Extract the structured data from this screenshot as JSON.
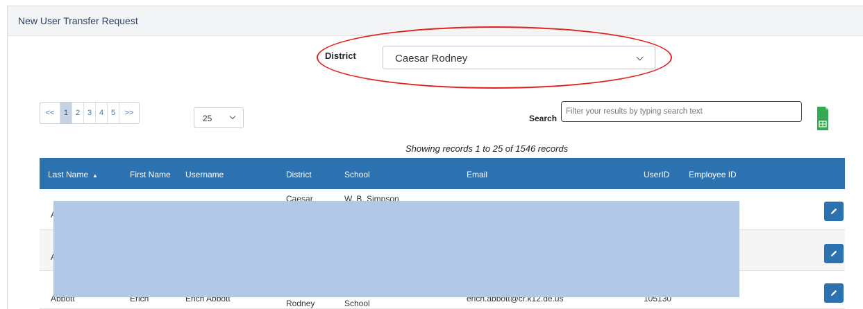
{
  "panel": {
    "title": "New User Transfer Request"
  },
  "district_filter": {
    "label": "District",
    "selected": "Caesar Rodney"
  },
  "pagination": {
    "pages": [
      "<<",
      "1",
      "2",
      "3",
      "4",
      "5",
      ">>"
    ],
    "active_page": "1",
    "page_size": "25"
  },
  "search": {
    "label": "Search",
    "placeholder": "Filter your results by typing search text"
  },
  "records_summary": "Showing records 1 to 25 of 1546 records",
  "table": {
    "columns": [
      "Last Name",
      "First Name",
      "Username",
      "District",
      "School",
      "Email",
      "UserID",
      "Employee ID"
    ],
    "sort_indicator": "▲",
    "rows": [
      {
        "last": "A",
        "first": "",
        "username": "",
        "district": "Caesar",
        "school": "W. B. Simpson",
        "email": "",
        "userid": ""
      },
      {
        "last": "A",
        "first": "",
        "username": "",
        "district": "",
        "school": "",
        "email": "",
        "userid": ""
      },
      {
        "last": "Abbott",
        "first": "Erich",
        "username": "Erich Abbott",
        "district": "Rodney",
        "school": "School",
        "email": "erich.abbott@cr.k12.de.us",
        "userid": "105130"
      }
    ]
  },
  "icons": {
    "edit": "pencil-icon",
    "export": "excel-export-icon",
    "dropdown": "chevron-down-icon"
  },
  "colors": {
    "header_blue": "#2c71b0",
    "redaction": "#b3c7e6",
    "highlight": "#e0201b"
  }
}
